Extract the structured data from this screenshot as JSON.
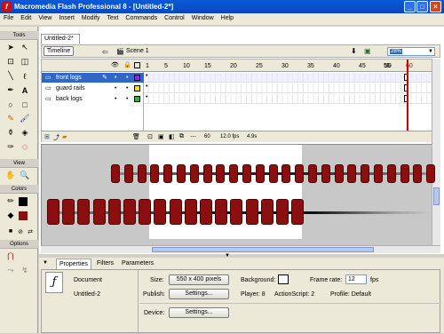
{
  "window": {
    "title": "Macromedia Flash Professional 8 - [Untitled-2*]"
  },
  "menu": [
    "File",
    "Edit",
    "View",
    "Insert",
    "Modify",
    "Text",
    "Commands",
    "Control",
    "Window",
    "Help"
  ],
  "tools_panel": {
    "tools_header": "Tools",
    "view_header": "View",
    "colors_header": "Colors",
    "options_header": "Options"
  },
  "document": {
    "tab_label": "Untitled-2*",
    "timeline_button": "Timeline",
    "scene_label": "Scene 1",
    "zoom": "28%"
  },
  "timeline": {
    "ruler_ticks": [
      "1",
      "5",
      "10",
      "15",
      "20",
      "25",
      "30",
      "35",
      "40",
      "45",
      "50",
      "55",
      "60"
    ],
    "layers": [
      {
        "name": "front logs",
        "color": "#a020f0",
        "selected": true
      },
      {
        "name": "guard rails",
        "color": "#f0e000",
        "selected": false
      },
      {
        "name": "back logs",
        "color": "#20c020",
        "selected": false
      }
    ],
    "current_frame": "60",
    "frame_rate": "12.0 fps",
    "elapsed": "4.9s"
  },
  "properties": {
    "tabs": [
      "Properties",
      "Filters",
      "Parameters"
    ],
    "doc_type": "Document",
    "doc_name": "Untitled-2",
    "size_label": "Size:",
    "size_value": "550 x 400 pixels",
    "background_label": "Background:",
    "frame_rate_label": "Frame rate:",
    "frame_rate_value": "12",
    "fps_unit": "fps",
    "publish_label": "Publish:",
    "settings_label": "Settings...",
    "player_info": "Player: 8",
    "actionscript_info": "ActionScript: 2",
    "profile_info": "Profile: Default",
    "device_label": "Device:",
    "device_settings_label": "Settings..."
  },
  "colors": {
    "log_fill": "#8b0f0f",
    "stage_bg": "#ffffff",
    "workspace": "#c8c8c8",
    "titlebar": "#0a5ad8"
  }
}
